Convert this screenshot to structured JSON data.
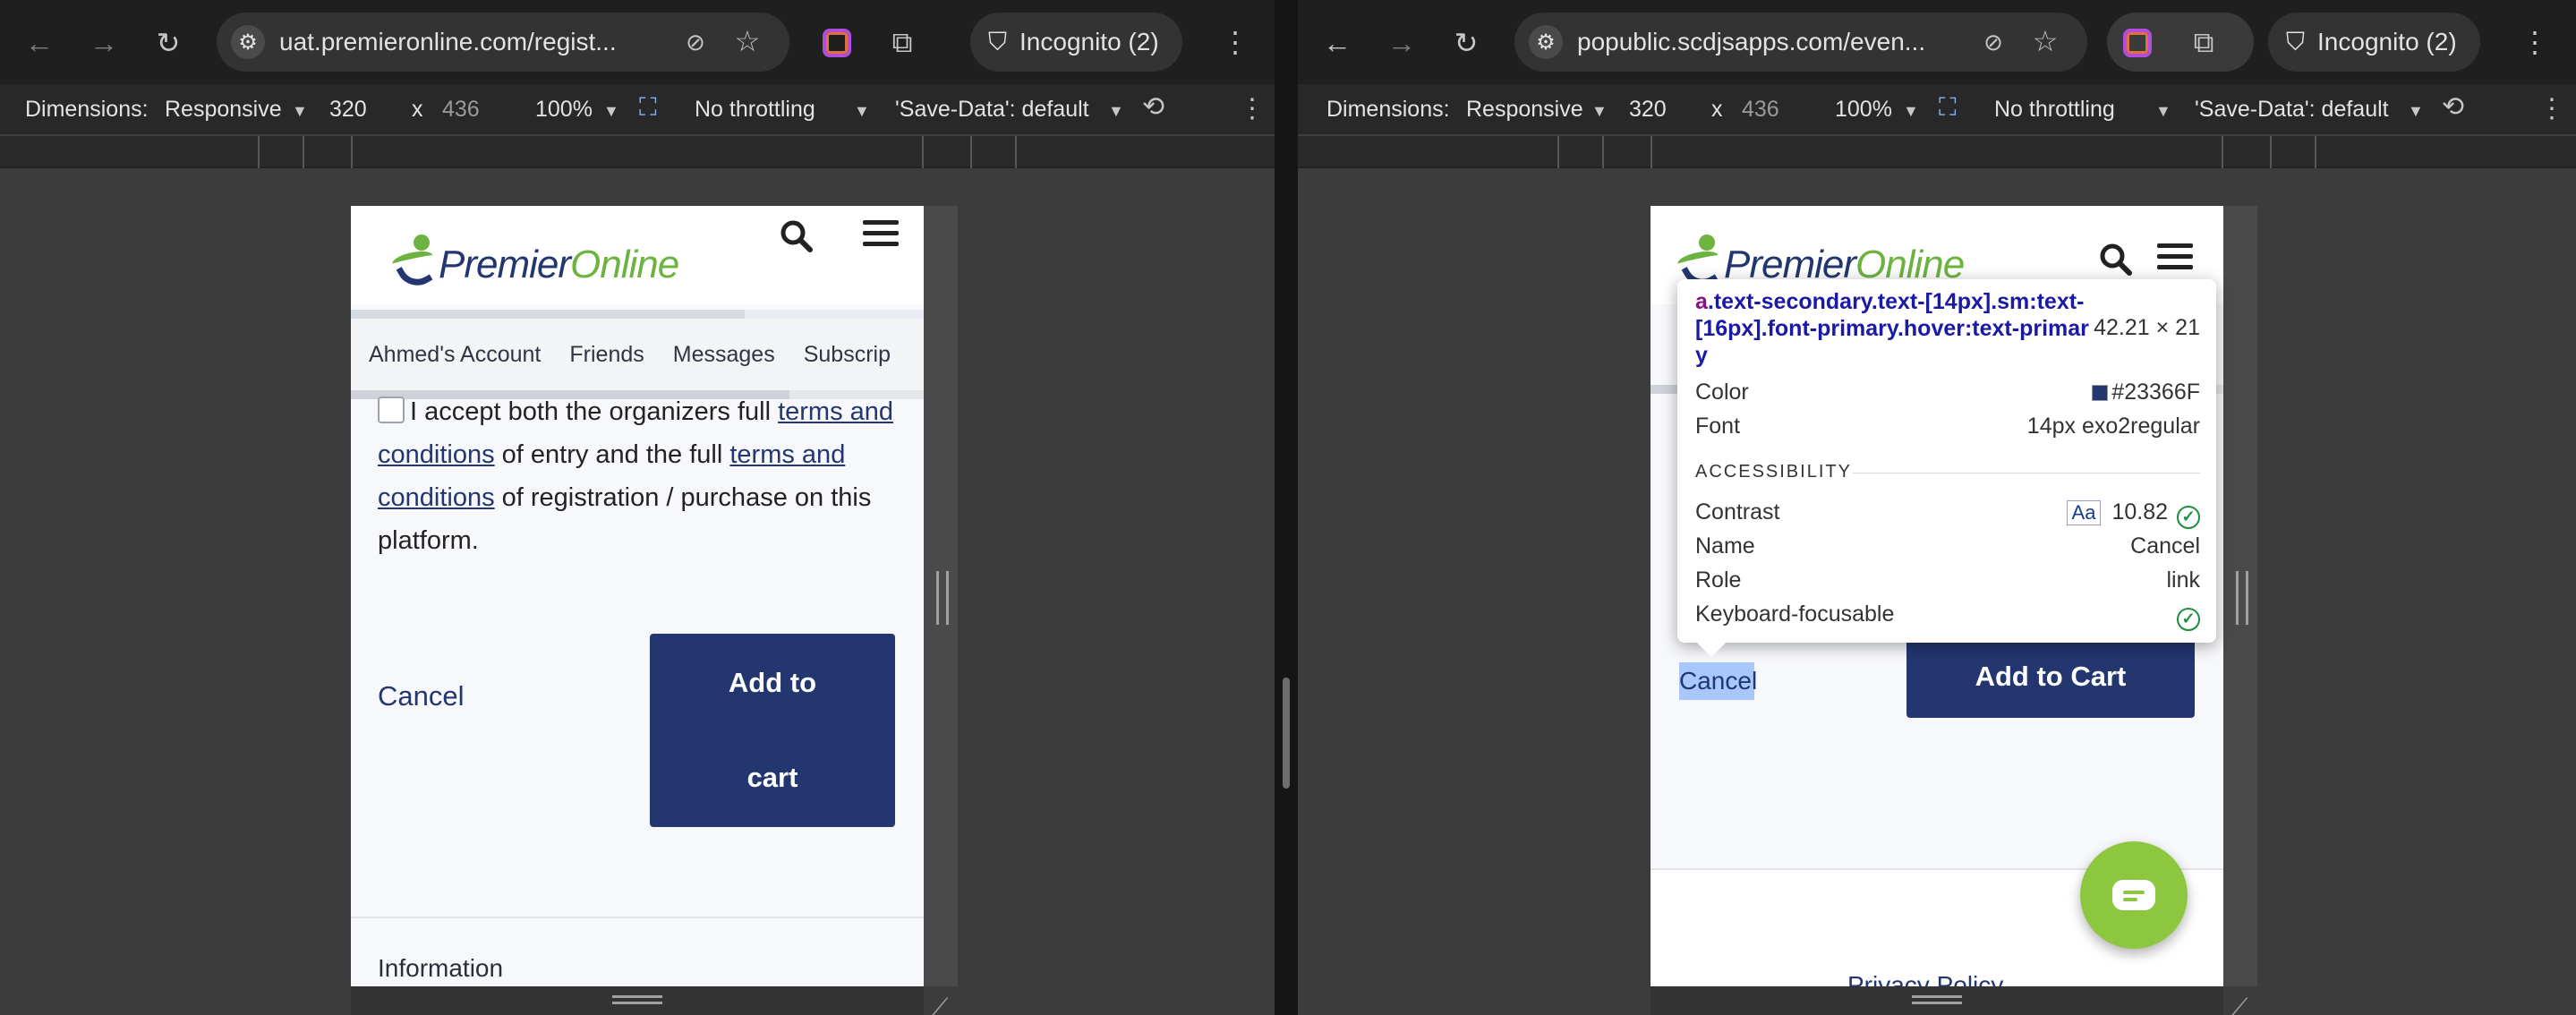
{
  "left": {
    "url": "uat.premieronline.com/regist...",
    "incognito": "Incognito (2)",
    "devtools": {
      "dimensions_label": "Dimensions:",
      "device": "Responsive",
      "width": "320",
      "times": "x",
      "height": "436",
      "zoom": "100%",
      "throttling": "No throttling",
      "save_data": "'Save-Data': default"
    },
    "site": {
      "logo_part1": "Premier",
      "logo_part2": "Online",
      "nav": [
        "Ahmed's Account",
        "Friends",
        "Messages",
        "Subscrip"
      ],
      "terms": {
        "pre": "I accept both the organizers full ",
        "link1": "terms and conditions",
        "mid": " of entry and the full ",
        "link2": "terms and conditions",
        "post": " of registration / purchase on this platform."
      },
      "cancel": "Cancel",
      "cart_line1": "Add to",
      "cart_line2": "cart",
      "information": "Information"
    }
  },
  "right": {
    "url": "popublic.scdjsapps.com/even...",
    "incognito": "Incognito (2)",
    "devtools": {
      "dimensions_label": "Dimensions:",
      "device": "Responsive",
      "width": "320",
      "times": "x",
      "height": "436",
      "zoom": "100%",
      "throttling": "No throttling",
      "save_data": "'Save-Data': default"
    },
    "site": {
      "logo_part1": "Premier",
      "logo_part2": "Online",
      "cancel": "Cancel",
      "cart": "Add to Cart",
      "privacy": "Privacy Policy"
    },
    "inspect": {
      "tag": "a",
      "selector": ".text-secondary.text-[14px].sm:text-[16px].font-primary.hover:text-primary",
      "size": "42.21 × 21",
      "color_label": "Color",
      "color_value": "#23366F",
      "font_label": "Font",
      "font_value": "14px exo2regular",
      "section": "ACCESSIBILITY",
      "contrast_label": "Contrast",
      "contrast_badge": "Aa",
      "contrast_value": "10.82",
      "name_label": "Name",
      "name_value": "Cancel",
      "role_label": "Role",
      "role_value": "link",
      "focus_label": "Keyboard-focusable"
    }
  },
  "colors": {
    "brand_navy": "#23366F",
    "brand_green": "#6CB33F",
    "chat_green": "#8DC63F"
  }
}
